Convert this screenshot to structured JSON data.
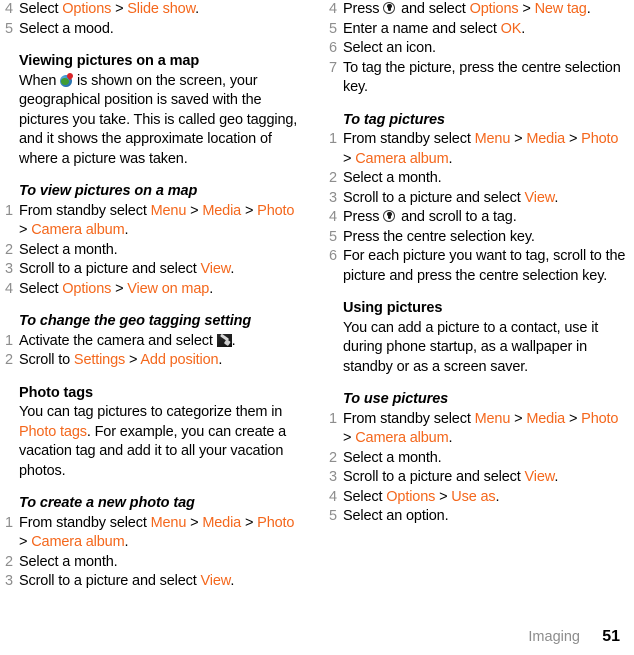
{
  "footer": {
    "chapter": "Imaging",
    "page_number": "51"
  },
  "left_column": {
    "top_steps": [
      {
        "num": "4",
        "parts": [
          {
            "t": "Select ",
            "c": "k"
          },
          {
            "t": "Options",
            "c": "o"
          },
          {
            "t": " > ",
            "c": "k"
          },
          {
            "t": "Slide show",
            "c": "o"
          },
          {
            "t": ".",
            "c": "k"
          }
        ]
      },
      {
        "num": "5",
        "parts": [
          {
            "t": "Select a mood.",
            "c": "k"
          }
        ]
      }
    ],
    "section_viewing": {
      "heading": "Viewing pictures on a map",
      "body_before_icon": "When ",
      "icon": "globe-icon",
      "body_after_icon": " is shown on the screen, your geographical position is saved with the pictures you take. This is called geo tagging, and it shows the approximate location of where a picture was taken."
    },
    "proc_view_map": {
      "heading": "To view pictures on a map",
      "steps": [
        {
          "num": "1",
          "parts": [
            {
              "t": "From standby select ",
              "c": "k"
            },
            {
              "t": "Menu",
              "c": "o"
            },
            {
              "t": " > ",
              "c": "k"
            },
            {
              "t": "Media",
              "c": "o"
            },
            {
              "t": " > ",
              "c": "k"
            },
            {
              "t": "Photo",
              "c": "o"
            },
            {
              "t": " > ",
              "c": "k"
            },
            {
              "t": "Camera album",
              "c": "o"
            },
            {
              "t": ".",
              "c": "k"
            }
          ]
        },
        {
          "num": "2",
          "parts": [
            {
              "t": "Select a month.",
              "c": "k"
            }
          ]
        },
        {
          "num": "3",
          "parts": [
            {
              "t": "Scroll to a picture and select ",
              "c": "k"
            },
            {
              "t": "View",
              "c": "o"
            },
            {
              "t": ".",
              "c": "k"
            }
          ]
        },
        {
          "num": "4",
          "parts": [
            {
              "t": "Select ",
              "c": "k"
            },
            {
              "t": "Options",
              "c": "o"
            },
            {
              "t": " > ",
              "c": "k"
            },
            {
              "t": "View on map",
              "c": "o"
            },
            {
              "t": ".",
              "c": "k"
            }
          ]
        }
      ]
    },
    "proc_geo_setting": {
      "heading": "To change the geo tagging setting",
      "step1_before_icon": "Activate the camera and select ",
      "step1_icon": "camera-settings-icon",
      "step1_after_icon": ".",
      "step1_num": "1",
      "step2_num": "2",
      "step2_parts": [
        {
          "t": "Scroll to ",
          "c": "k"
        },
        {
          "t": "Settings",
          "c": "o"
        },
        {
          "t": " > ",
          "c": "k"
        },
        {
          "t": "Add position",
          "c": "o"
        },
        {
          "t": ".",
          "c": "k"
        }
      ]
    },
    "section_photo_tags": {
      "heading": "Photo tags",
      "parts": [
        {
          "t": "You can tag pictures to categorize them in ",
          "c": "k"
        },
        {
          "t": "Photo tags",
          "c": "o"
        },
        {
          "t": ". For example, you can create a vacation tag and add it to all your vacation photos.",
          "c": "k"
        }
      ]
    },
    "proc_new_tag": {
      "heading": "To create a new photo tag",
      "steps": [
        {
          "num": "1",
          "parts": [
            {
              "t": "From standby select ",
              "c": "k"
            },
            {
              "t": "Menu",
              "c": "o"
            },
            {
              "t": " > ",
              "c": "k"
            },
            {
              "t": "Media",
              "c": "o"
            },
            {
              "t": " > ",
              "c": "k"
            },
            {
              "t": "Photo",
              "c": "o"
            },
            {
              "t": " > ",
              "c": "k"
            },
            {
              "t": "Camera album",
              "c": "o"
            },
            {
              "t": ".",
              "c": "k"
            }
          ]
        },
        {
          "num": "2",
          "parts": [
            {
              "t": "Select a month.",
              "c": "k"
            }
          ]
        },
        {
          "num": "3",
          "parts": [
            {
              "t": "Scroll to a picture and select ",
              "c": "k"
            },
            {
              "t": "View",
              "c": "o"
            },
            {
              "t": ".",
              "c": "k"
            }
          ]
        }
      ]
    }
  },
  "right_column": {
    "proc_new_tag_cont": {
      "step4_num": "4",
      "step4_before_icon": "Press ",
      "step4_icon": "centre-selection-key-icon",
      "step4_parts_after": [
        {
          "t": " and select ",
          "c": "k"
        },
        {
          "t": "Options",
          "c": "o"
        },
        {
          "t": " > ",
          "c": "k"
        },
        {
          "t": "New tag",
          "c": "o"
        },
        {
          "t": ".",
          "c": "k"
        }
      ],
      "steps": [
        {
          "num": "5",
          "parts": [
            {
              "t": "Enter a name and select ",
              "c": "k"
            },
            {
              "t": "OK",
              "c": "o"
            },
            {
              "t": ".",
              "c": "k"
            }
          ]
        },
        {
          "num": "6",
          "parts": [
            {
              "t": "Select an icon.",
              "c": "k"
            }
          ]
        },
        {
          "num": "7",
          "parts": [
            {
              "t": "To tag the picture, press the centre selection key.",
              "c": "k"
            }
          ]
        }
      ]
    },
    "proc_tag_pictures": {
      "heading": "To tag pictures",
      "steps_before": [
        {
          "num": "1",
          "parts": [
            {
              "t": "From standby select ",
              "c": "k"
            },
            {
              "t": "Menu",
              "c": "o"
            },
            {
              "t": " > ",
              "c": "k"
            },
            {
              "t": "Media",
              "c": "o"
            },
            {
              "t": " > ",
              "c": "k"
            },
            {
              "t": "Photo",
              "c": "o"
            },
            {
              "t": " > ",
              "c": "k"
            },
            {
              "t": "Camera album",
              "c": "o"
            },
            {
              "t": ".",
              "c": "k"
            }
          ]
        },
        {
          "num": "2",
          "parts": [
            {
              "t": "Select a month.",
              "c": "k"
            }
          ]
        },
        {
          "num": "3",
          "parts": [
            {
              "t": "Scroll to a picture and select ",
              "c": "k"
            },
            {
              "t": "View",
              "c": "o"
            },
            {
              "t": ".",
              "c": "k"
            }
          ]
        }
      ],
      "step4_num": "4",
      "step4_before_icon": "Press ",
      "step4_icon": "centre-selection-key-icon",
      "step4_after_icon": " and scroll to a tag.",
      "steps_after": [
        {
          "num": "5",
          "parts": [
            {
              "t": "Press the centre selection key.",
              "c": "k"
            }
          ]
        },
        {
          "num": "6",
          "parts": [
            {
              "t": "For each picture you want to tag, scroll to the picture and press the centre selection key.",
              "c": "k"
            }
          ]
        }
      ]
    },
    "section_using_pictures": {
      "heading": "Using pictures",
      "body": "You can add a picture to a contact, use it during phone startup, as a wallpaper in standby or as a screen saver."
    },
    "proc_use_pictures": {
      "heading": "To use pictures",
      "steps": [
        {
          "num": "1",
          "parts": [
            {
              "t": "From standby select ",
              "c": "k"
            },
            {
              "t": "Menu",
              "c": "o"
            },
            {
              "t": " > ",
              "c": "k"
            },
            {
              "t": "Media",
              "c": "o"
            },
            {
              "t": " > ",
              "c": "k"
            },
            {
              "t": "Photo",
              "c": "o"
            },
            {
              "t": " > ",
              "c": "k"
            },
            {
              "t": "Camera album",
              "c": "o"
            },
            {
              "t": ".",
              "c": "k"
            }
          ]
        },
        {
          "num": "2",
          "parts": [
            {
              "t": "Select a month.",
              "c": "k"
            }
          ]
        },
        {
          "num": "3",
          "parts": [
            {
              "t": "Scroll to a picture and select ",
              "c": "k"
            },
            {
              "t": "View",
              "c": "o"
            },
            {
              "t": ".",
              "c": "k"
            }
          ]
        },
        {
          "num": "4",
          "parts": [
            {
              "t": "Select ",
              "c": "k"
            },
            {
              "t": "Options",
              "c": "o"
            },
            {
              "t": " > ",
              "c": "k"
            },
            {
              "t": "Use as",
              "c": "o"
            },
            {
              "t": ".",
              "c": "k"
            }
          ]
        },
        {
          "num": "5",
          "parts": [
            {
              "t": "Select an option.",
              "c": "k"
            }
          ]
        }
      ]
    }
  }
}
